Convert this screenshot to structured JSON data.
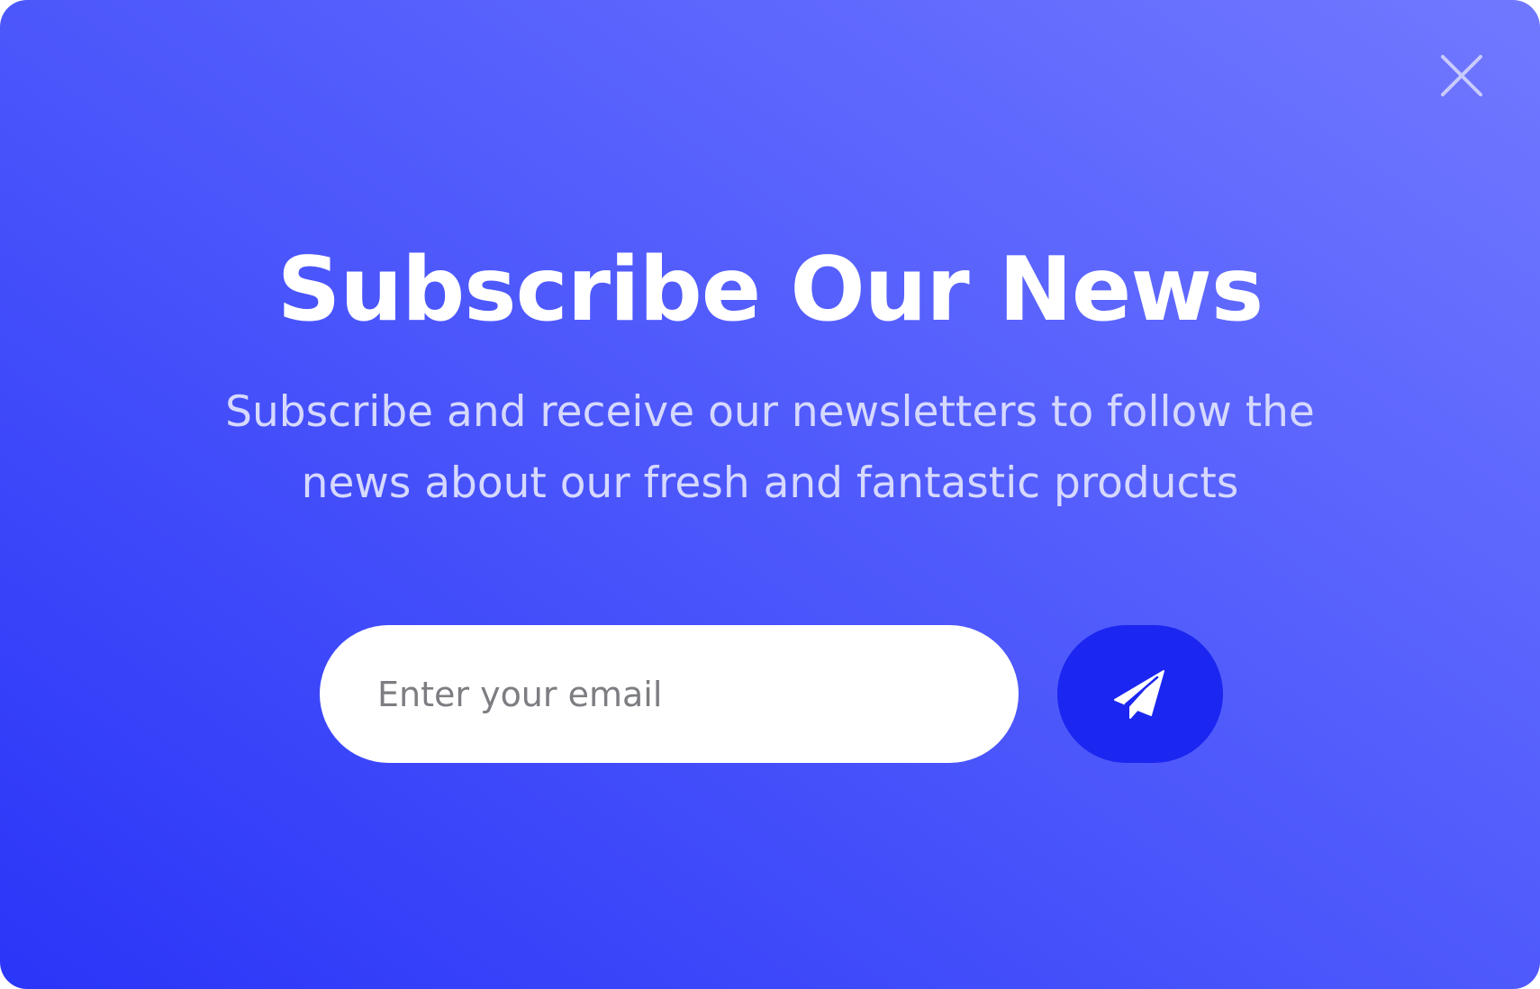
{
  "modal": {
    "title": "Subscribe Our News",
    "subtitle_line1": "Subscribe and receive our newsletters to follow the",
    "subtitle_line2": "news about our fresh and fantastic products",
    "email": {
      "placeholder": "Enter your email",
      "value": ""
    },
    "send_button": {
      "icon": "paper-plane-icon",
      "color": "#1b26f1"
    },
    "close_button": {
      "icon": "close-icon"
    }
  },
  "colors": {
    "background_gradient_start": "#2a35f8",
    "background_gradient_end": "#7178ff",
    "title": "#ffffff",
    "subtitle": "#d6d9ff"
  }
}
